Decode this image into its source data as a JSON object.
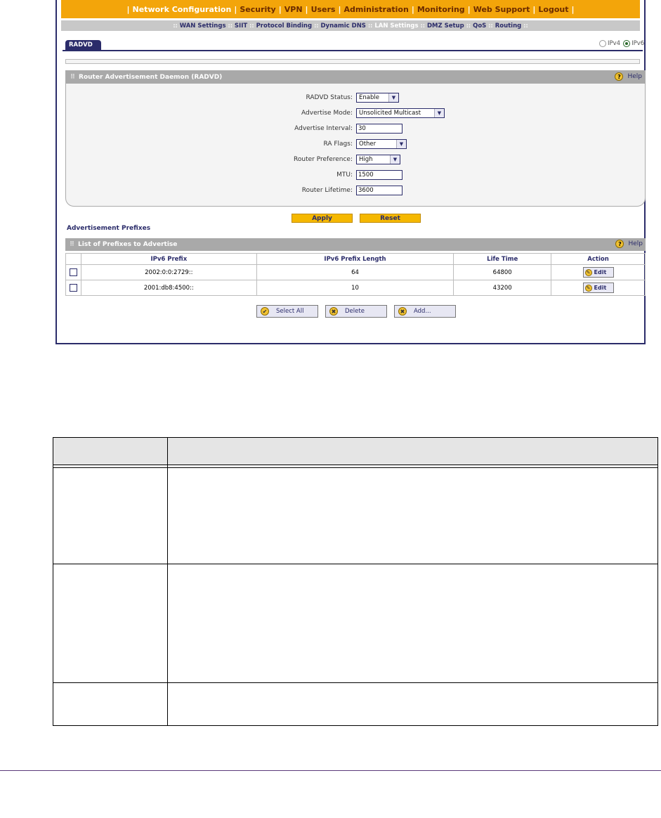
{
  "top_nav": {
    "items": [
      "Network Configuration",
      "Security",
      "VPN",
      "Users",
      "Administration",
      "Monitoring",
      "Web Support",
      "Logout"
    ],
    "separator": "|"
  },
  "sub_nav": {
    "items": [
      "WAN Settings",
      "SIIT",
      "Protocol Binding",
      "Dynamic DNS",
      "LAN Settings",
      "DMZ Setup",
      "QoS",
      "Routing"
    ],
    "separator": "::"
  },
  "tab": {
    "label": "RADVD"
  },
  "ip_selector": {
    "ipv4": "IPv4",
    "ipv6": "IPv6",
    "selected": "IPv6"
  },
  "radvd_section": {
    "title": "Router Advertisement Daemon (RADVD)",
    "help": "Help",
    "help_icon": "?",
    "fields": {
      "status": {
        "label": "RADVD Status:",
        "value": "Enable"
      },
      "mode": {
        "label": "Advertise Mode:",
        "value": "Unsolicited Multicast"
      },
      "interval": {
        "label": "Advertise Interval:",
        "value": "30"
      },
      "flags": {
        "label": "RA Flags:",
        "value": "Other"
      },
      "preference": {
        "label": "Router Preference:",
        "value": "High"
      },
      "mtu": {
        "label": "MTU:",
        "value": "1500"
      },
      "lifetime": {
        "label": "Router Lifetime:",
        "value": "3600"
      }
    }
  },
  "actions": {
    "apply": "Apply",
    "reset": "Reset"
  },
  "prefixes": {
    "heading": "Advertisement Prefixes",
    "list_title": "List of Prefixes to Advertise",
    "help": "Help",
    "help_icon": "?",
    "columns": [
      "IPv6 Prefix",
      "IPv6 Prefix Length",
      "Life Time",
      "Action"
    ],
    "rows": [
      {
        "prefix": "2002:0:0:2729::",
        "length": "64",
        "life": "64800",
        "action": "Edit"
      },
      {
        "prefix": "2001:db8:4500::",
        "length": "10",
        "life": "43200",
        "action": "Edit"
      }
    ],
    "buttons": {
      "select_all": "Select All",
      "delete": "Delete",
      "add": "Add..."
    }
  },
  "colors": {
    "nav_orange": "#f3a50a",
    "navy": "#2b2c6a",
    "section_gray": "#a9a9a9",
    "button_yellow": "#f5b800"
  }
}
